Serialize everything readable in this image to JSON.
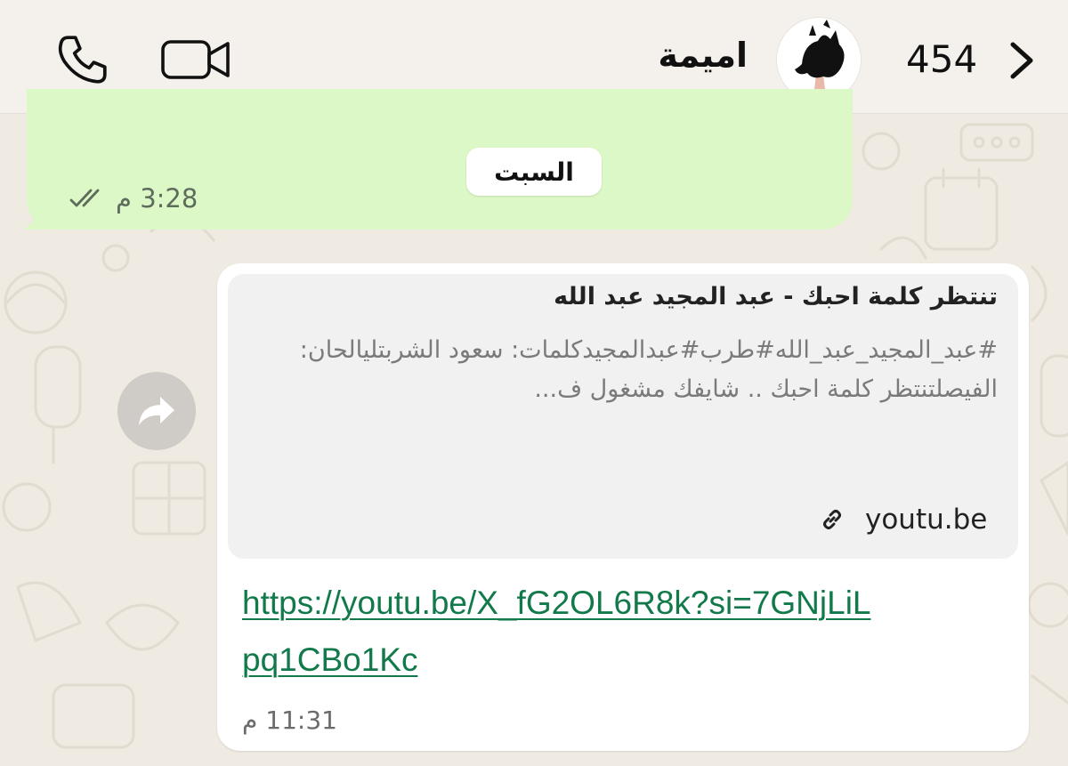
{
  "header": {
    "contact_name": "اميمة",
    "unread_count": "454",
    "call_icon": "phone-icon",
    "video_icon": "video-camera-icon",
    "back_icon": "chevron-left-icon"
  },
  "chat": {
    "outgoing": {
      "time": "3:28 م",
      "status_icon": "double-check-icon"
    },
    "day_divider": "السبت",
    "incoming": {
      "forward_icon": "forward-arrow-icon",
      "preview": {
        "title": "تنتظر كلمة احبك - عبد المجيد عبد الله",
        "description": "#عبد_المجيد_عبد_الله#طرب#عبدالمجيدكلمات: سعود الشربتليالحان: الفيصلتنتظر كلمة احبك .. شايفك مشغول ف...",
        "domain": "youtu.be",
        "link_icon": "link-icon"
      },
      "url": "https://youtu.be/X_fG2OL6R8k?si=7GNjLiLpq1CBo1Kc",
      "time": "11:31 م"
    }
  },
  "colors": {
    "outgoing_bubble": "#dcf8c6",
    "link": "#127a4a",
    "wallpaper": "#efeae2"
  }
}
